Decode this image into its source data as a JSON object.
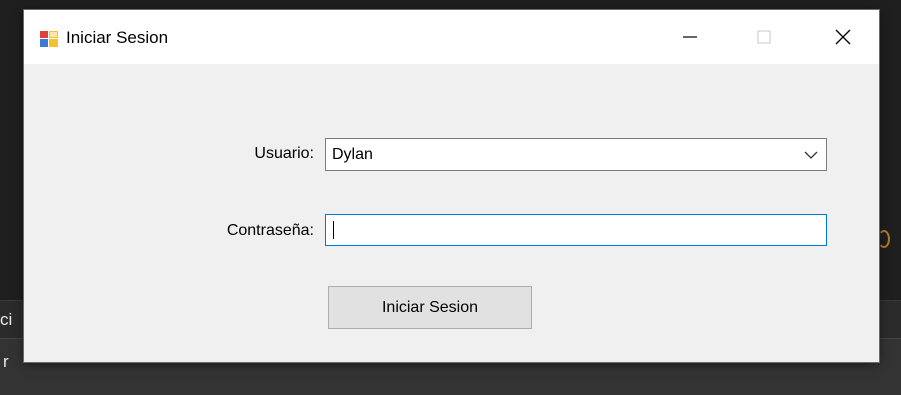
{
  "window": {
    "title": "Iniciar Sesion",
    "controls": {
      "minimize_icon": "minimize-icon",
      "maximize_icon": "maximize-icon",
      "close_icon": "close-icon"
    }
  },
  "form": {
    "user_label": "Usuario:",
    "user_value": "Dylan",
    "password_label": "Contraseña:",
    "password_value": "",
    "submit_label": "Iniciar Sesion"
  },
  "background": {
    "fragment_1": "ci",
    "fragment_2": "r"
  },
  "colors": {
    "focus_border": "#0078d7",
    "button_bg": "#e1e1e1",
    "window_bg": "#f0f0f0"
  }
}
